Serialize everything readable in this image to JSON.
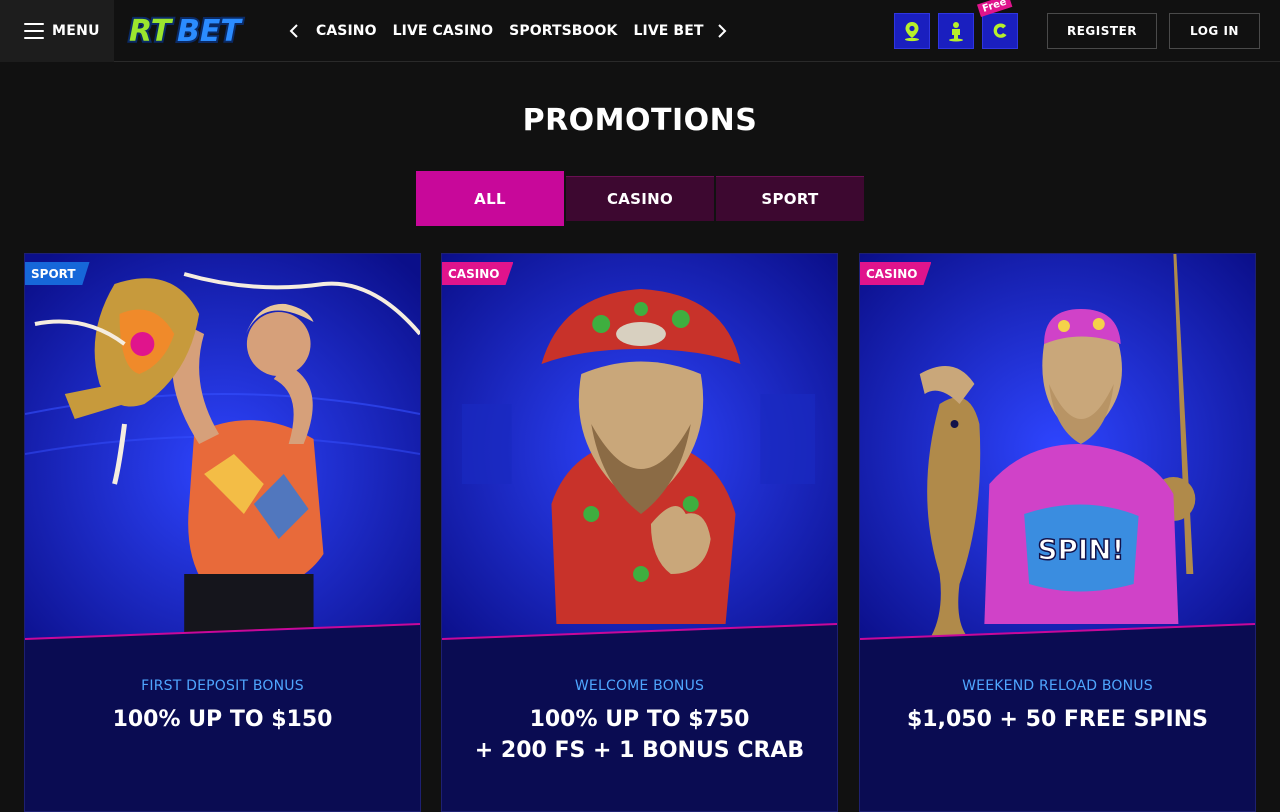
{
  "header": {
    "menu_label": "MENU",
    "logo_text": "RTBET",
    "nav": [
      "CASINO",
      "LIVE CASINO",
      "SPORTSBOOK",
      "LIVE BETTING"
    ],
    "free_badge": "Free",
    "register_label": "REGISTER",
    "login_label": "LOG IN",
    "icons": [
      "location-pin-icon",
      "person-icon",
      "coin-icon"
    ]
  },
  "page": {
    "title": "PROMOTIONS"
  },
  "tabs": [
    {
      "label": "ALL",
      "active": true
    },
    {
      "label": "CASINO",
      "active": false
    },
    {
      "label": "SPORT",
      "active": false
    }
  ],
  "cards": [
    {
      "tag": "SPORT",
      "tag_color": "#1667d9",
      "subtitle": "FIRST DEPOSIT BONUS",
      "title": "100% UP TO $150"
    },
    {
      "tag": "CASINO",
      "tag_color": "#e0148c",
      "subtitle": "WELCOME BONUS",
      "title": "100% UP TO $750\n+ 200 FS + 1 BONUS CRAB"
    },
    {
      "tag": "CASINO",
      "tag_color": "#e0148c",
      "subtitle": "WEEKEND RELOAD BONUS",
      "title": "$1,050 + 50 FREE SPINS"
    }
  ],
  "colors": {
    "accent": "#c8089a",
    "tab_inactive": "#3d0830",
    "card_bg": "#0a0c52",
    "subtitle": "#4fa6ff",
    "logo_green": "#9be52e",
    "logo_blue": "#2b8cff"
  }
}
